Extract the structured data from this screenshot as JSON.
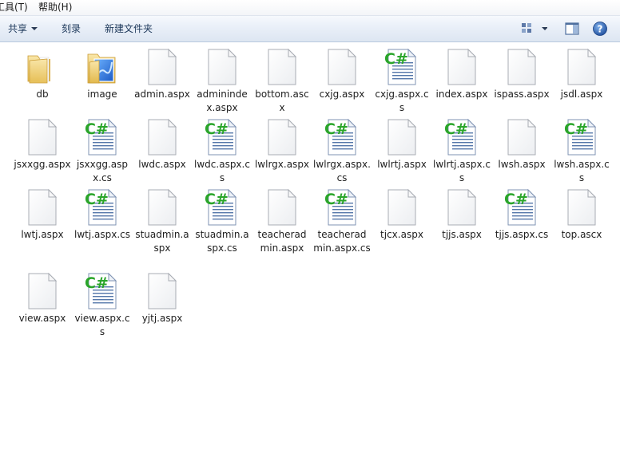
{
  "menubar": {
    "items": [
      {
        "label": "工具(T)"
      },
      {
        "label": "帮助(H)"
      }
    ]
  },
  "toolbar": {
    "share_label": "共享",
    "burn_label": "刻录",
    "new_folder_label": "新建文件夹"
  },
  "files": [
    {
      "name": "db",
      "type": "folder"
    },
    {
      "name": "image",
      "type": "image-folder"
    },
    {
      "name": "admin.aspx",
      "type": "file"
    },
    {
      "name": "adminindex.aspx",
      "type": "file"
    },
    {
      "name": "bottom.ascx",
      "type": "file"
    },
    {
      "name": "cxjg.aspx",
      "type": "file"
    },
    {
      "name": "cxjg.aspx.cs",
      "type": "cs"
    },
    {
      "name": "index.aspx",
      "type": "file"
    },
    {
      "name": "ispass.aspx",
      "type": "file"
    },
    {
      "name": "jsdl.aspx",
      "type": "file"
    },
    {
      "name": "jsxxgg.aspx",
      "type": "file"
    },
    {
      "name": "jsxxgg.aspx.cs",
      "type": "cs"
    },
    {
      "name": "lwdc.aspx",
      "type": "file"
    },
    {
      "name": "lwdc.aspx.cs",
      "type": "cs"
    },
    {
      "name": "lwlrgx.aspx",
      "type": "file"
    },
    {
      "name": "lwlrgx.aspx.cs",
      "type": "cs"
    },
    {
      "name": "lwlrtj.aspx",
      "type": "file"
    },
    {
      "name": "lwlrtj.aspx.cs",
      "type": "cs"
    },
    {
      "name": "lwsh.aspx",
      "type": "file"
    },
    {
      "name": "lwsh.aspx.cs",
      "type": "cs"
    },
    {
      "name": "lwtj.aspx",
      "type": "file"
    },
    {
      "name": "lwtj.aspx.cs",
      "type": "cs"
    },
    {
      "name": "stuadmin.aspx",
      "type": "file"
    },
    {
      "name": "stuadmin.aspx.cs",
      "type": "cs"
    },
    {
      "name": "teacheradmin.aspx",
      "type": "file"
    },
    {
      "name": "teacheradmin.aspx.cs",
      "type": "cs"
    },
    {
      "name": "tjcx.aspx",
      "type": "file"
    },
    {
      "name": "tjjs.aspx",
      "type": "file"
    },
    {
      "name": "tjjs.aspx.cs",
      "type": "cs"
    },
    {
      "name": "top.ascx",
      "type": "file"
    },
    {
      "name": "view.aspx",
      "type": "file"
    },
    {
      "name": "view.aspx.cs",
      "type": "cs"
    },
    {
      "name": "yjtj.aspx",
      "type": "file"
    }
  ],
  "icons": {
    "cs_glyph": "C#",
    "cs_color": "#2aa52a",
    "folder_color": "#f1d27a"
  }
}
